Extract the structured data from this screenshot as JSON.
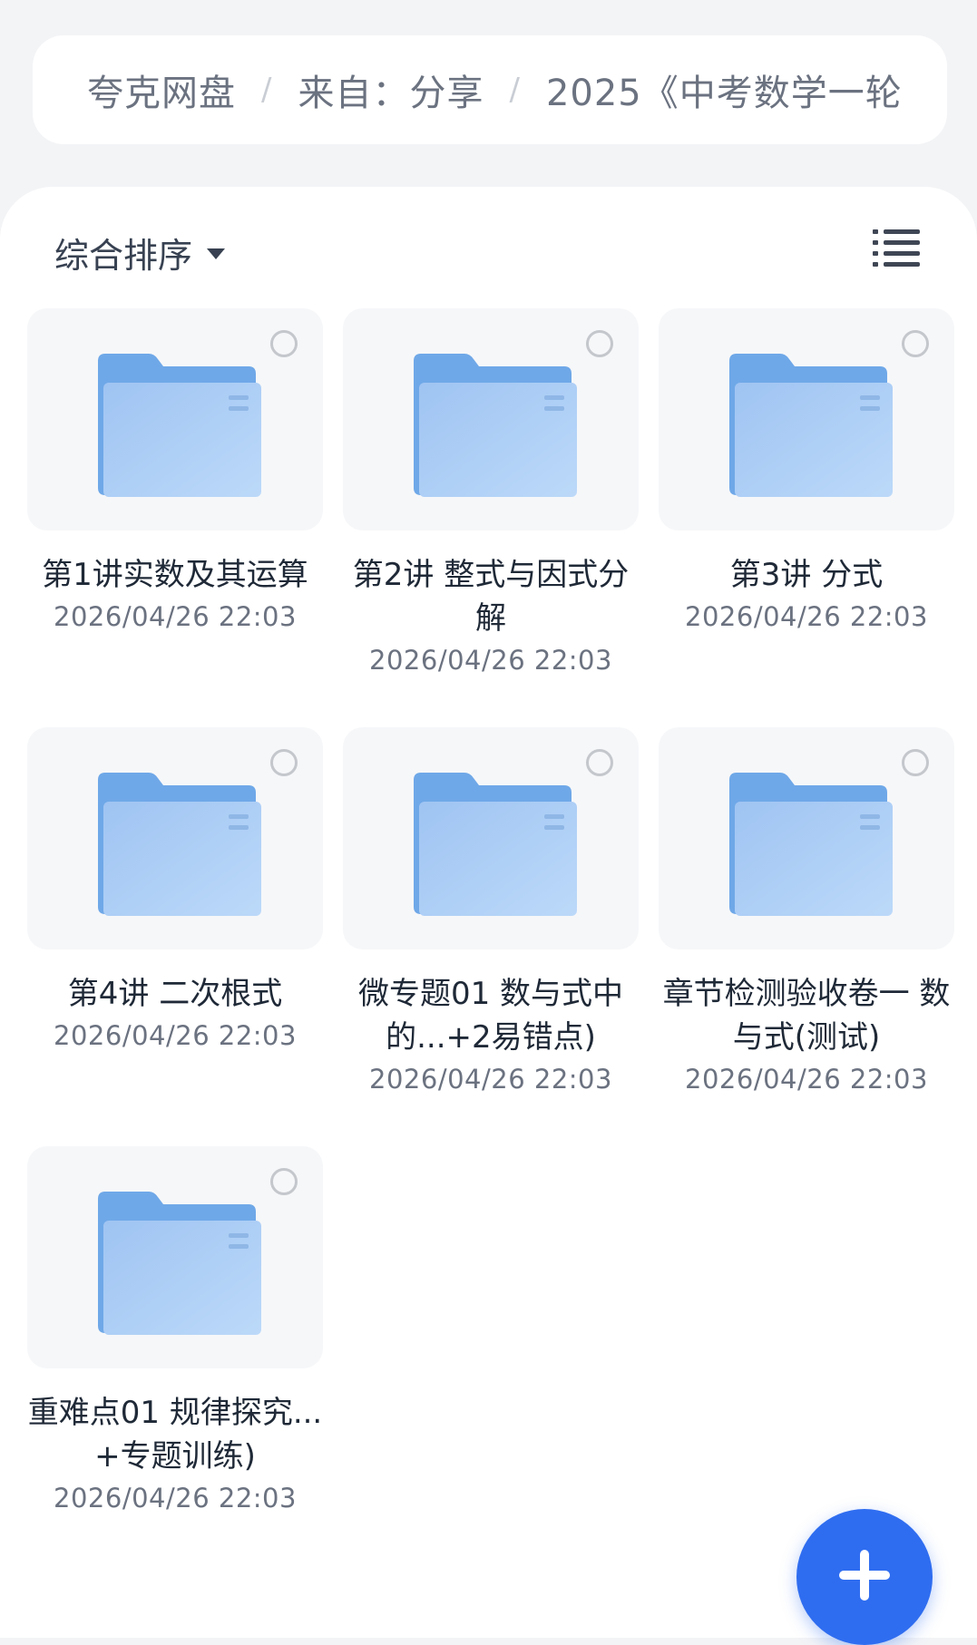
{
  "breadcrumb": {
    "root": "夸克网盘",
    "middle": "来自：分享",
    "current": "2025《中考数学一轮",
    "separator": "/"
  },
  "toolbar": {
    "sort_label": "综合排序",
    "list_view_icon": "list-view-icon"
  },
  "colors": {
    "folder_back": "#6fa8e8",
    "folder_front": "#a9cdf5",
    "fab": "#2f6df0"
  },
  "folders": [
    {
      "name": "第1讲实数及其运算",
      "date": "2026/04/26 22:03"
    },
    {
      "name": "第2讲 整式与因式分解",
      "date": "2026/04/26 22:03"
    },
    {
      "name": "第3讲 分式",
      "date": "2026/04/26 22:03"
    },
    {
      "name": "第4讲 二次根式",
      "date": "2026/04/26 22:03"
    },
    {
      "name": "微专题01 数与式中的...+2易错点)",
      "date": "2026/04/26 22:03"
    },
    {
      "name": "章节检测验收卷一 数与式(测试)",
      "date": "2026/04/26 22:03"
    },
    {
      "name": "重难点01 规律探究...+专题训练)",
      "date": "2026/04/26 22:03"
    }
  ],
  "fab": {
    "icon": "plus-icon"
  }
}
